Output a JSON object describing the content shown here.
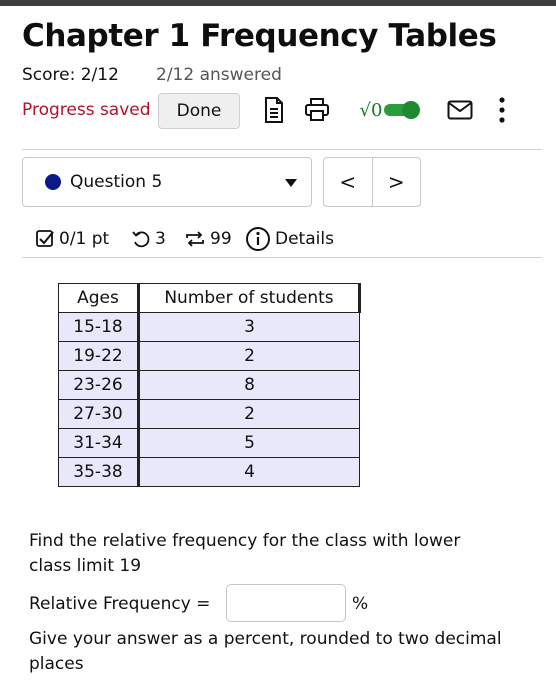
{
  "header": {
    "title": "Chapter 1 Frequency Tables",
    "score": "Score: 2/12",
    "answered": "2/12 answered",
    "progress": "Progress saved",
    "done_label": "Done",
    "sqrt_label": "√0",
    "accent_red": "#b0122a",
    "accent_green": "#127a2a"
  },
  "toolbar_icons": [
    "document-icon",
    "printer-icon",
    "sqrt-toggle-icon",
    "mail-icon",
    "more-vertical-icon"
  ],
  "question_selector": {
    "label": "Question 5",
    "dot_color": "#0a1a8a",
    "prev": "<",
    "next": ">"
  },
  "meta": {
    "points": "0/1 pt",
    "retries": "3",
    "attempts": "99",
    "details": "Details"
  },
  "table": {
    "headers": [
      "Ages",
      "Number of students"
    ],
    "rows": [
      [
        "15-18",
        "3"
      ],
      [
        "19-22",
        "2"
      ],
      [
        "23-26",
        "8"
      ],
      [
        "27-30",
        "2"
      ],
      [
        "31-34",
        "5"
      ],
      [
        "35-38",
        "4"
      ]
    ]
  },
  "problem": {
    "prompt_line1": "Find the relative frequency for the class with lower",
    "prompt_line2": "class limit 19",
    "field_label": "Relative Frequency =",
    "answer_value": "",
    "unit": "%",
    "instruction_line1": "Give your answer as a percent, rounded to two decimal",
    "instruction_line2": "places"
  }
}
